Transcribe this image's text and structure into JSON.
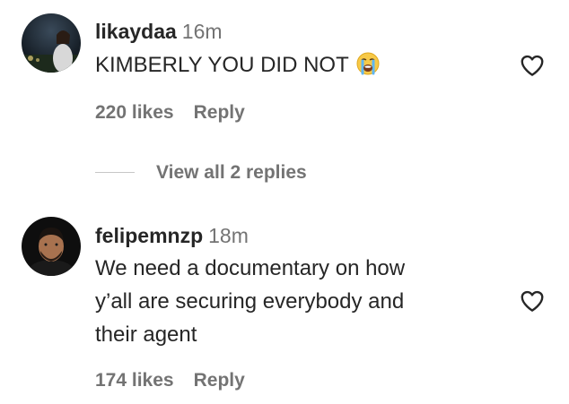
{
  "comments": [
    {
      "username": "likaydaa",
      "timestamp": "16m",
      "text": "KIMBERLY YOU DID NOT",
      "emoji": "loudly-crying-face-icon",
      "likes": "220 likes",
      "reply_label": "Reply",
      "view_replies": "View all 2 replies"
    },
    {
      "username": "felipemnzp",
      "timestamp": "18m",
      "text": "We need a documentary on how\ny’all are securing everybody and\ntheir agent",
      "likes": "174 likes",
      "reply_label": "Reply"
    }
  ],
  "icons": {
    "like": "heart-outline-icon"
  },
  "colors": {
    "primary_text": "#262626",
    "secondary_text": "#737373",
    "icon": "#262626"
  }
}
